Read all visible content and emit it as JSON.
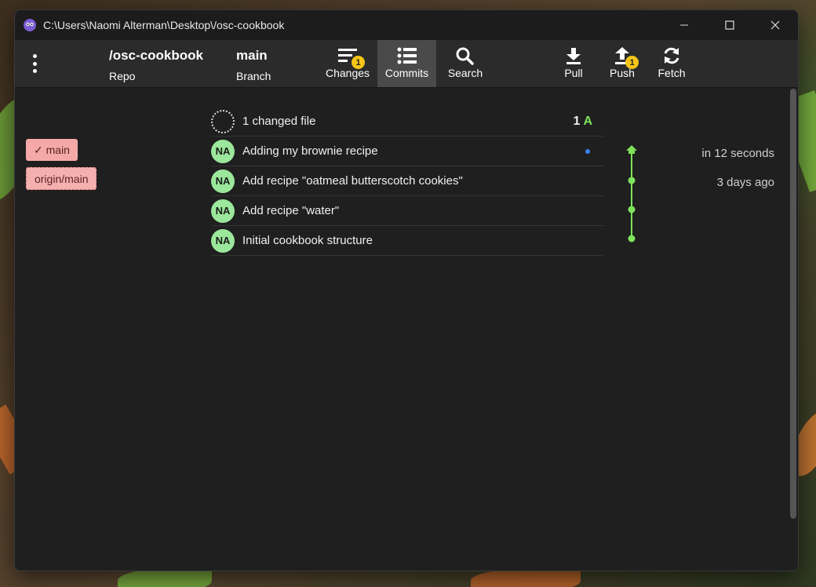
{
  "window": {
    "title": "C:\\Users\\Naomi Alterman\\Desktop\\/osc-cookbook"
  },
  "toolbar": {
    "repo_value": "/osc-cookbook",
    "repo_label": "Repo",
    "branch_value": "main",
    "branch_label": "Branch",
    "changes_label": "Changes",
    "changes_badge": "1",
    "commits_label": "Commits",
    "search_label": "Search",
    "pull_label": "Pull",
    "push_label": "Push",
    "push_badge": "1",
    "fetch_label": "Fetch"
  },
  "refs": {
    "local": "✓ main",
    "remote": "origin/main"
  },
  "changes_row": {
    "text": "1 changed file",
    "count": "1",
    "status_letter": "A"
  },
  "commits": [
    {
      "initials": "NA",
      "message": "Adding my brownie recipe",
      "date": "in 12 seconds"
    },
    {
      "initials": "NA",
      "message": "Add recipe \"oatmeal butterscotch cookies\"",
      "date": "3 days ago"
    },
    {
      "initials": "NA",
      "message": "Add recipe \"water\"",
      "date": ""
    },
    {
      "initials": "NA",
      "message": "Initial cookbook structure",
      "date": ""
    }
  ],
  "colors": {
    "accent_green": "#7ee35a",
    "badge_yellow": "#f5c518",
    "ref_pink": "#f4a9a8"
  }
}
